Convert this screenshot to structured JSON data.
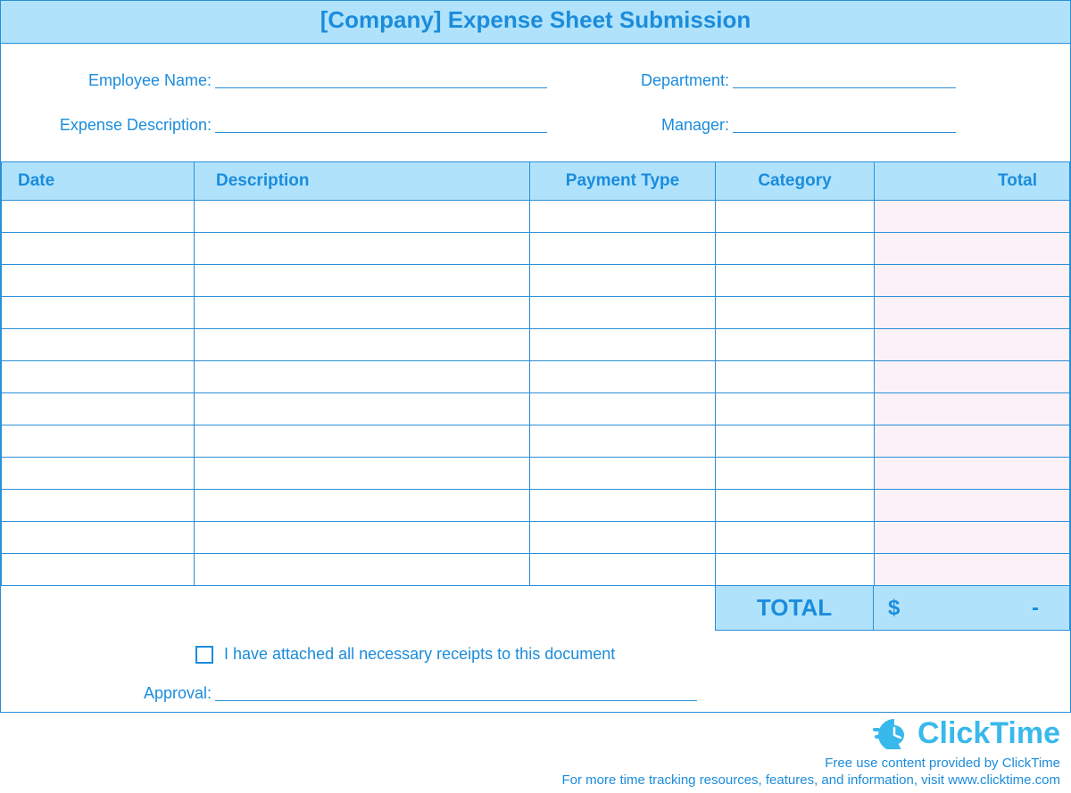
{
  "title": "[Company] Expense Sheet Submission",
  "fields": {
    "employee_name_label": "Employee Name:",
    "department_label": "Department:",
    "expense_desc_label": "Expense Description:",
    "manager_label": "Manager:",
    "approval_label": "Approval:"
  },
  "columns": {
    "date": "Date",
    "description": "Description",
    "payment_type": "Payment Type",
    "category": "Category",
    "total": "Total"
  },
  "rows": [
    {
      "date": "",
      "description": "",
      "payment_type": "",
      "category": "",
      "total": ""
    },
    {
      "date": "",
      "description": "",
      "payment_type": "",
      "category": "",
      "total": ""
    },
    {
      "date": "",
      "description": "",
      "payment_type": "",
      "category": "",
      "total": ""
    },
    {
      "date": "",
      "description": "",
      "payment_type": "",
      "category": "",
      "total": ""
    },
    {
      "date": "",
      "description": "",
      "payment_type": "",
      "category": "",
      "total": ""
    },
    {
      "date": "",
      "description": "",
      "payment_type": "",
      "category": "",
      "total": ""
    },
    {
      "date": "",
      "description": "",
      "payment_type": "",
      "category": "",
      "total": ""
    },
    {
      "date": "",
      "description": "",
      "payment_type": "",
      "category": "",
      "total": ""
    },
    {
      "date": "",
      "description": "",
      "payment_type": "",
      "category": "",
      "total": ""
    },
    {
      "date": "",
      "description": "",
      "payment_type": "",
      "category": "",
      "total": ""
    },
    {
      "date": "",
      "description": "",
      "payment_type": "",
      "category": "",
      "total": ""
    },
    {
      "date": "",
      "description": "",
      "payment_type": "",
      "category": "",
      "total": ""
    }
  ],
  "grand_total": {
    "label": "TOTAL",
    "currency": "$",
    "value": "-"
  },
  "checkbox_label": "I have attached all necessary receipts to this document",
  "brand": "ClickTime",
  "footer_line1": "Free use content provided by ClickTime",
  "footer_line2": "For more time tracking resources, features, and information, visit www.clicktime.com"
}
